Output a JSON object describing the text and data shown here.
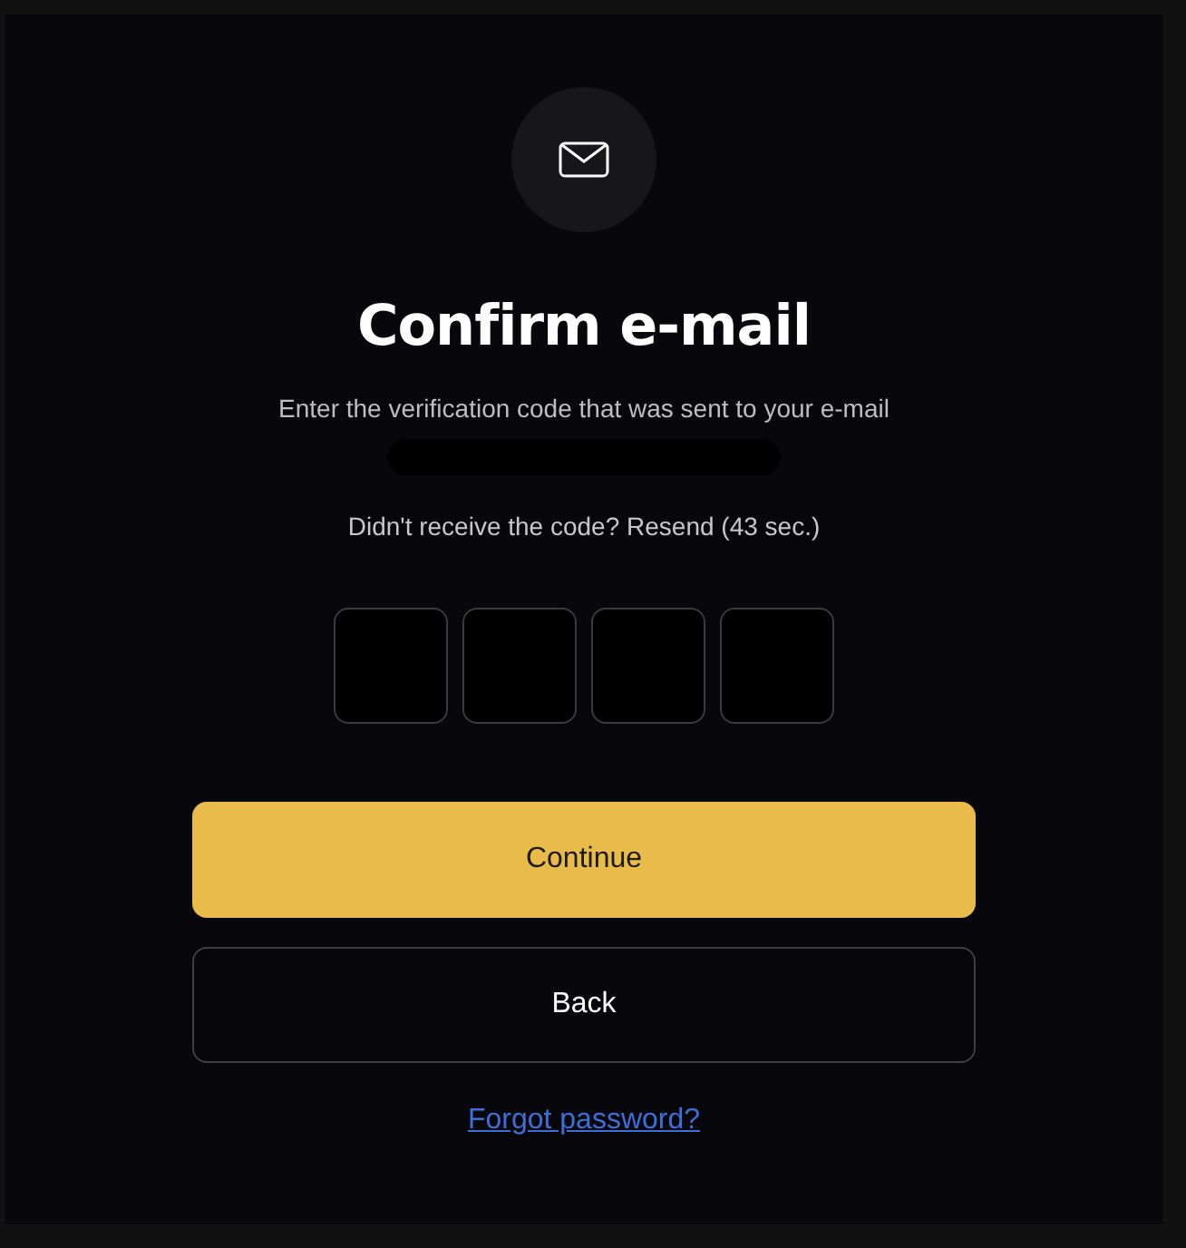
{
  "header": {
    "kind": "mail"
  },
  "title": "Confirm e-mail",
  "subtitle": "Enter the verification code that was sent to your e-mail",
  "email": {
    "kind": "redacted"
  },
  "resend_text": "Didn't receive the code? Resend (43 sec.)",
  "code_fields": [
    {
      "kind": "digit"
    },
    {
      "kind": "digit"
    },
    {
      "kind": "digit"
    },
    {
      "kind": "digit"
    }
  ],
  "buttons": [
    {
      "label": "Continue",
      "kind": "primary"
    },
    {
      "label": "Back",
      "kind": "outline"
    }
  ],
  "link": "Forgot password?"
}
